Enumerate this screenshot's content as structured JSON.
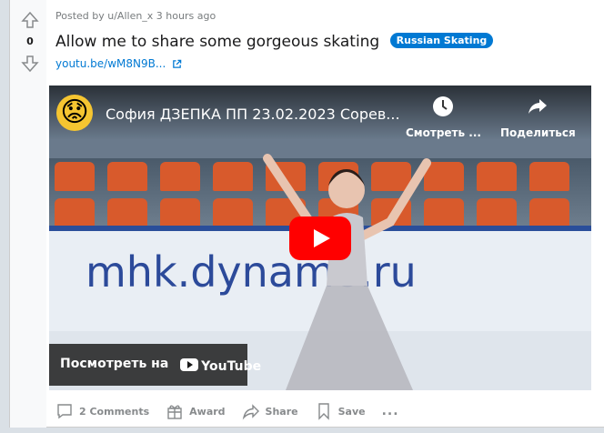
{
  "post": {
    "score": "0",
    "meta": "Posted by u/Allen_x 3 hours ago",
    "title": "Allow me to share some gorgeous skating",
    "flair": "Russian Skating",
    "link": "youtu.be/wM8N9B...",
    "colors": {
      "flair": "#0079d3",
      "link": "#0079d3",
      "muted": "#878a8c"
    }
  },
  "video": {
    "channel_avatar": "worried-face-emoji",
    "title": "София ДЗЕПКА ПП 23.02.2023 Сорев...",
    "watch_later_label": "Смотреть ...",
    "share_label": "Поделиться",
    "board_text": "mhk.dynamo.ru",
    "watch_on_label": "Посмотреть на",
    "youtube_label": "YouTube"
  },
  "actions": {
    "comments": "2 Comments",
    "award": "Award",
    "share": "Share",
    "save": "Save",
    "more": "..."
  }
}
